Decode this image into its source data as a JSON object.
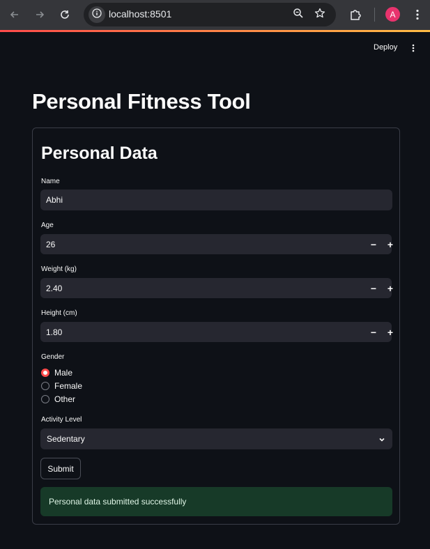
{
  "browser": {
    "url": "localhost:8501",
    "avatar_letter": "A",
    "icons": {
      "back": "arrow-left-icon",
      "forward": "arrow-right-icon",
      "reload": "reload-icon",
      "site_info": "info-icon",
      "zoom": "zoom-icon",
      "bookmark": "star-icon",
      "extensions": "puzzle-icon",
      "menu": "kebab-menu-icon"
    }
  },
  "app_header": {
    "deploy_label": "Deploy"
  },
  "page": {
    "title": "Personal Fitness Tool"
  },
  "form": {
    "section_title": "Personal Data",
    "name": {
      "label": "Name",
      "value": "Abhi"
    },
    "age": {
      "label": "Age",
      "value": "26"
    },
    "weight": {
      "label": "Weight (kg)",
      "value": "2.40"
    },
    "height": {
      "label": "Height (cm)",
      "value": "1.80"
    },
    "stepper": {
      "minus": "−",
      "plus": "+"
    },
    "gender": {
      "label": "Gender",
      "options": [
        "Male",
        "Female",
        "Other"
      ],
      "selected": "Male"
    },
    "activity": {
      "label": "Activity Level",
      "value": "Sedentary"
    },
    "submit_label": "Submit",
    "success_message": "Personal data submitted successfully"
  },
  "colors": {
    "background": "#0e1117",
    "input_bg": "#262730",
    "accent": "#ff4b4b",
    "success_bg": "#173a28"
  }
}
